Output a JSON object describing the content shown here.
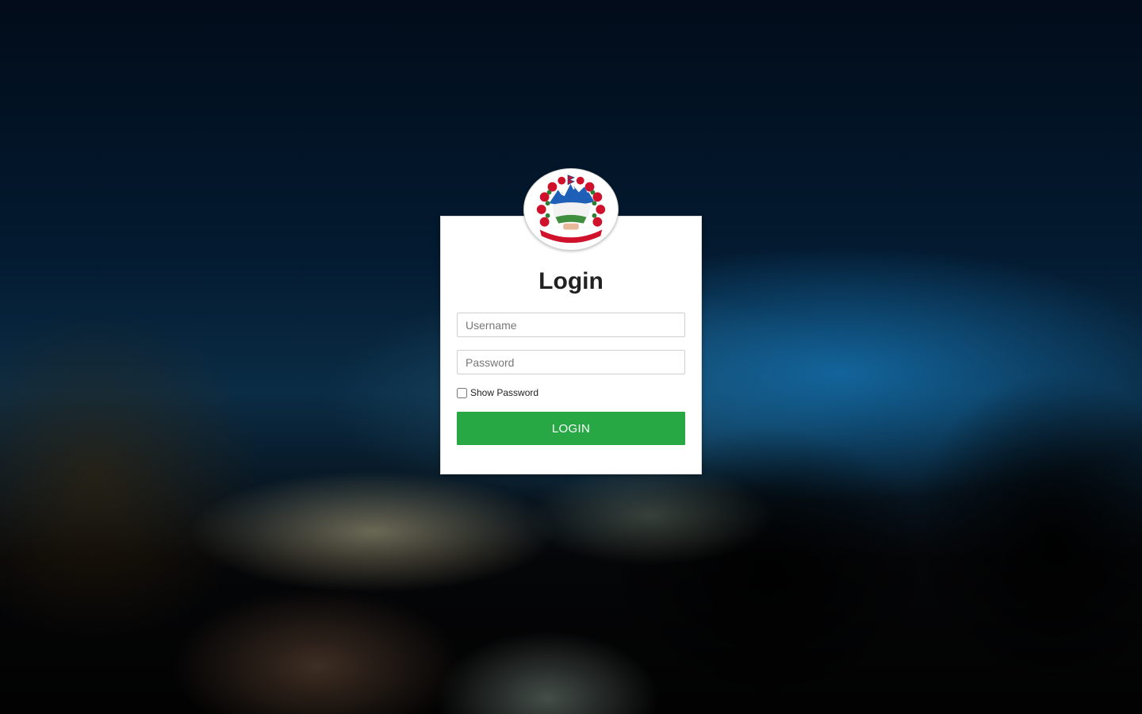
{
  "login": {
    "title": "Login",
    "username_placeholder": "Username",
    "password_placeholder": "Password",
    "show_password_label": "Show Password",
    "show_password_checked": false,
    "submit_label": "LOGIN"
  },
  "logo": {
    "icon": "nepal-government-emblem-icon"
  },
  "colors": {
    "button": "#28a745",
    "card": "#ffffff",
    "title_text": "#222222"
  }
}
